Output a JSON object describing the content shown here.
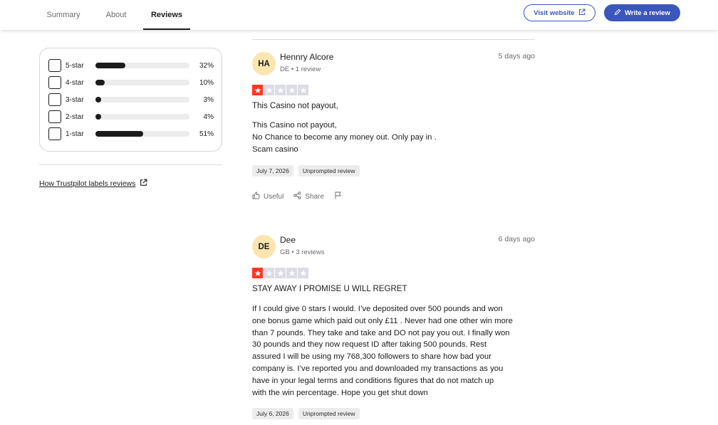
{
  "nav": {
    "tabs": [
      {
        "label": "Summary",
        "active": false
      },
      {
        "label": "About",
        "active": false
      },
      {
        "label": "Reviews",
        "active": true
      }
    ],
    "visit_website": "Visit website",
    "write_review": "Write a review",
    "accent_color": "#3c57bc"
  },
  "filters": {
    "rows": [
      {
        "label": "5-star",
        "percent_text": "32%",
        "percent": 32
      },
      {
        "label": "4-star",
        "percent_text": "10%",
        "percent": 10
      },
      {
        "label": "3-star",
        "percent_text": "3%",
        "percent": 3
      },
      {
        "label": "2-star",
        "percent_text": "4%",
        "percent": 4
      },
      {
        "label": "1-star",
        "percent_text": "51%",
        "percent": 51
      }
    ],
    "how_link": "How Trustpilot labels reviews"
  },
  "reviews": [
    {
      "initials": "HA",
      "name": "Hennry Alcore",
      "meta": "DE • 1 review",
      "time_ago": "5 days ago",
      "rating": 1,
      "title": "This Casino not payout,",
      "body": [
        "This Casino not payout,",
        "No Chance to become any money out. Only pay in .",
        "Scam casino"
      ],
      "date_tag": "July 7, 2026",
      "type_tag": "Unprompted review",
      "actions": {
        "useful": "Useful",
        "share": "Share"
      }
    },
    {
      "initials": "DE",
      "name": "Dee",
      "meta": "GB • 3 reviews",
      "time_ago": "6 days ago",
      "rating": 1,
      "title": "STAY AWAY I PROMISE U WILL REGRET",
      "body": [
        "If I could give 0 stars I would. I’ve deposited over 500 pounds and won",
        "one bonus game which paid out only £11 . Never had one other win more",
        "than 7 pounds. They take and take and DO not pay you out. I finally won",
        "30 pounds and they now request ID after taking 500 pounds. Rest",
        "assured I will be using my 768,300 followers to share how bad your",
        "company is. I’ve reported you and downloaded my transactions as you",
        "have in your legal terms and conditions figures that do not match up",
        "with the win percentage. Hope you get shut down"
      ],
      "date_tag": "July 6, 2026",
      "type_tag": "Unprompted review"
    }
  ],
  "colors": {
    "star_on": "#ff3722",
    "star_off": "#dcdce6",
    "avatar_bg": "#fde5b0"
  }
}
